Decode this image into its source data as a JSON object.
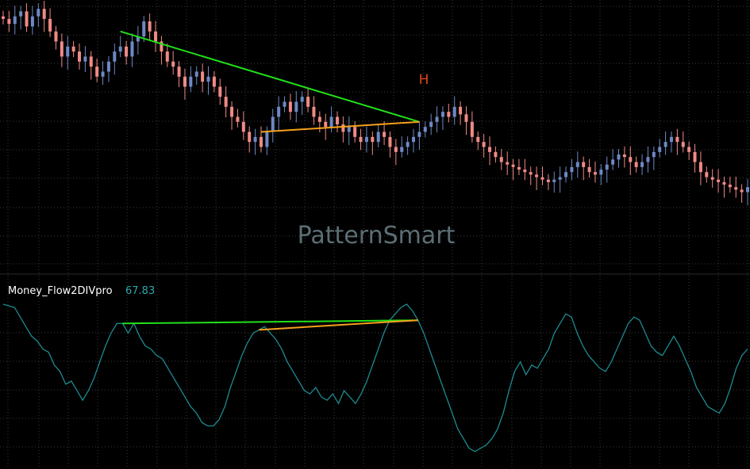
{
  "watermark": "PatternSmart",
  "indicator": {
    "name": "Money_Flow2DIVpro",
    "value": "67.83"
  },
  "pattern_label": "H",
  "colors": {
    "background": "#000000",
    "grid": "#3a3a3a",
    "up_candle": "#6d88c4",
    "down_candle": "#f08a86",
    "indicator_line": "#1e8a8f",
    "divergence_green": "#22e01a",
    "divergence_orange": "#f5a11c",
    "pattern_label": "#e0431a",
    "watermark": "#5c6e73",
    "indicator_value": "#2ea7ad"
  },
  "chart_data": [
    {
      "type": "candlestick",
      "description_series": "price",
      "x_count": 126,
      "y_domain": [
        0,
        100
      ],
      "closes": [
        95,
        93,
        96,
        98,
        92,
        96,
        99,
        95,
        90,
        86,
        80,
        84,
        82,
        78,
        80,
        76,
        72,
        74,
        78,
        82,
        84,
        80,
        86,
        88,
        94,
        90,
        86,
        82,
        78,
        76,
        72,
        68,
        72,
        74,
        70,
        72,
        68,
        64,
        60,
        56,
        54,
        50,
        46,
        48,
        44,
        50,
        56,
        60,
        62,
        58,
        62,
        64,
        60,
        56,
        54,
        52,
        56,
        53,
        50,
        52,
        48,
        46,
        48,
        46,
        50,
        48,
        44,
        42,
        44,
        46,
        48,
        50,
        52,
        54,
        56,
        58,
        56,
        60,
        57,
        54,
        48,
        46,
        44,
        42,
        40,
        38,
        37,
        36,
        35,
        34,
        33,
        32,
        31,
        30,
        31,
        32,
        34,
        36,
        38,
        36,
        34,
        33,
        35,
        37,
        39,
        41,
        40,
        38,
        36,
        38,
        40,
        42,
        44,
        46,
        48,
        46,
        44,
        42,
        38,
        34,
        32,
        31,
        30,
        29,
        28,
        27,
        26,
        28
      ],
      "annotations": [
        "H"
      ],
      "divergence_lines": [
        {
          "color": "green",
          "from_index": 20,
          "to_index": 71
        },
        {
          "color": "orange",
          "from_index": 44,
          "to_index": 71
        }
      ]
    },
    {
      "type": "line",
      "name": "Money_Flow2DIVpro",
      "last_value": 67.83,
      "y_domain": [
        0,
        100
      ],
      "values": [
        98,
        97,
        96,
        90,
        84,
        78,
        75,
        70,
        68,
        60,
        56,
        48,
        50,
        44,
        38,
        44,
        52,
        62,
        72,
        80,
        86,
        86,
        80,
        86,
        78,
        72,
        70,
        66,
        64,
        58,
        52,
        46,
        40,
        34,
        30,
        24,
        22,
        22,
        26,
        34,
        46,
        56,
        66,
        74,
        80,
        82,
        84,
        80,
        76,
        70,
        62,
        56,
        50,
        44,
        42,
        46,
        40,
        38,
        42,
        36,
        44,
        40,
        36,
        42,
        50,
        60,
        70,
        80,
        88,
        92,
        96,
        98,
        94,
        88,
        80,
        70,
        60,
        50,
        40,
        30,
        20,
        14,
        8,
        6,
        8,
        10,
        14,
        20,
        30,
        44,
        56,
        62,
        54,
        60,
        58,
        64,
        70,
        80,
        86,
        92,
        90,
        80,
        72,
        66,
        62,
        58,
        56,
        62,
        70,
        78,
        86,
        90,
        88,
        80,
        72,
        68,
        66,
        72,
        78,
        72,
        64,
        56,
        46,
        40,
        34,
        32,
        30,
        36,
        46,
        58,
        66,
        70
      ]
    }
  ]
}
